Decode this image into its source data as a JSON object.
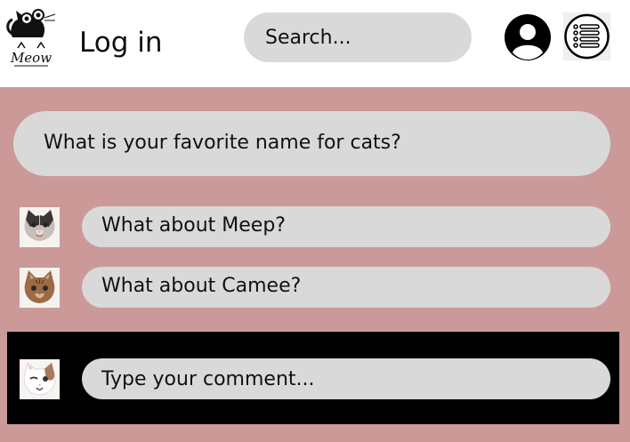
{
  "header": {
    "logo_text": "Meow",
    "login_label": "Log in",
    "search_placeholder": "Search...",
    "profile_icon": "user-circle-icon",
    "menu_icon": "menu-list-icon"
  },
  "thread": {
    "question": "What is your favorite name for cats?",
    "comments": [
      {
        "avatar": "tabby-cat-avatar",
        "text": "What about Meep?"
      },
      {
        "avatar": "brown-cat-avatar",
        "text": "What about Camee?"
      }
    ]
  },
  "composer": {
    "avatar": "white-cat-avatar",
    "placeholder": "Type your comment..."
  },
  "colors": {
    "background": "#cc9999",
    "bubble": "#d9d9d9",
    "composer_bar": "#000000"
  }
}
